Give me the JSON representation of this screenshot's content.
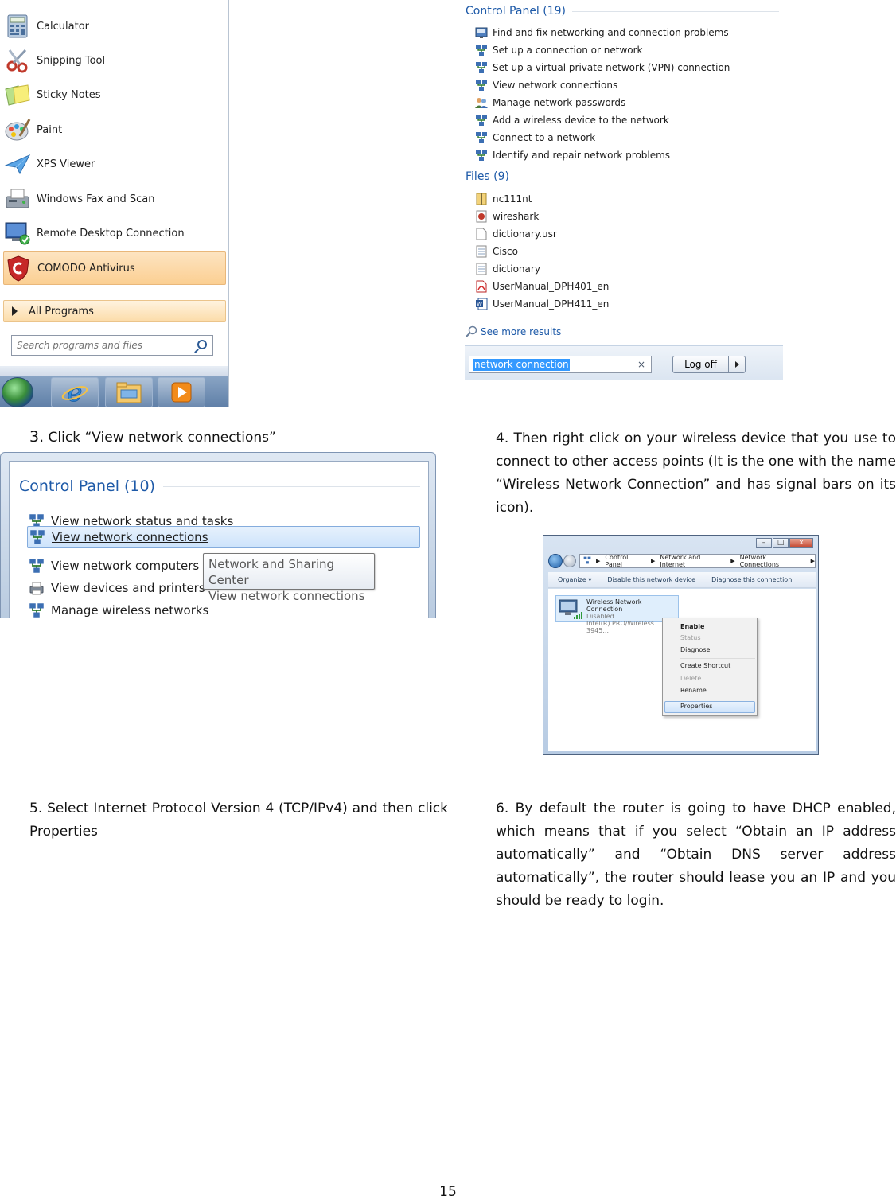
{
  "start_menu": {
    "items": [
      {
        "label": "Calculator",
        "icon": "calculator-icon"
      },
      {
        "label": "Snipping Tool",
        "icon": "scissors-icon"
      },
      {
        "label": "Sticky Notes",
        "icon": "sticky-notes-icon"
      },
      {
        "label": "Paint",
        "icon": "paint-palette-icon"
      },
      {
        "label": "XPS Viewer",
        "icon": "paper-plane-icon"
      },
      {
        "label": "Windows Fax and Scan",
        "icon": "fax-icon"
      },
      {
        "label": "Remote Desktop Connection",
        "icon": "remote-desktop-icon"
      },
      {
        "label": "COMODO Antivirus",
        "icon": "comodo-shield-icon",
        "highlighted": true
      }
    ],
    "all_programs_label": "All Programs",
    "search_placeholder": "Search programs and files",
    "taskbar_icons": [
      "start-orb-icon",
      "internet-explorer-icon",
      "file-explorer-icon",
      "media-player-icon"
    ]
  },
  "search_results": {
    "control_panel_heading": "Control Panel (19)",
    "control_panel_items": [
      {
        "label": "Find and fix networking and connection problems",
        "icon": "troubleshoot-icon"
      },
      {
        "label": "Set up a connection or network",
        "icon": "network-icon"
      },
      {
        "label": "Set up a virtual private network (VPN) connection",
        "icon": "network-icon"
      },
      {
        "label": "View network connections",
        "icon": "network-icon"
      },
      {
        "label": "Manage network passwords",
        "icon": "users-icon"
      },
      {
        "label": "Add a wireless device to the network",
        "icon": "network-icon"
      },
      {
        "label": "Connect to a network",
        "icon": "network-icon"
      },
      {
        "label": "Identify and repair network problems",
        "icon": "network-icon"
      }
    ],
    "files_heading": "Files (9)",
    "file_items": [
      {
        "label": "nc111nt",
        "icon": "archive-icon"
      },
      {
        "label": "wireshark",
        "icon": "wireshark-icon"
      },
      {
        "label": "dictionary.usr",
        "icon": "blank-file-icon"
      },
      {
        "label": "Cisco",
        "icon": "text-file-icon"
      },
      {
        "label": "dictionary",
        "icon": "text-file-icon"
      },
      {
        "label": "UserManual_DPH401_en",
        "icon": "pdf-icon"
      },
      {
        "label": "UserManual_DPH411_en",
        "icon": "word-doc-icon"
      }
    ],
    "see_more_label": "See more results",
    "search_value": "network connection",
    "clear_symbol": "×",
    "log_off_label": "Log off"
  },
  "step3": {
    "number": "3.",
    "text": " Click “View network connections”"
  },
  "control_panel_popup": {
    "heading": "Control Panel (10)",
    "items": [
      {
        "label": "View network status and tasks"
      },
      {
        "label": "View network connections",
        "selected": true
      },
      {
        "label": "View network computers a"
      },
      {
        "label": "View devices and printers"
      },
      {
        "label": "Manage wireless networks"
      }
    ],
    "tooltip_line1": "Network and Sharing Center",
    "tooltip_line2": "View network connections"
  },
  "step4": {
    "text": "4. Then right click on your wireless device that you use to connect to other access points (It is the one with the name “Wireless Network Connection” and has signal bars on its icon)."
  },
  "network_window": {
    "breadcrumb": [
      "Control Panel",
      "Network and Internet",
      "Network Connections"
    ],
    "toolbar": [
      "Organize ▾",
      "Disable this network device",
      "Diagnose this connection"
    ],
    "connection": {
      "name": "Wireless Network Connection",
      "status": "Disabled",
      "adapter": "Intel(R) PRO/Wireless 3945..."
    },
    "context_menu": [
      "Enable",
      "Status",
      "Diagnose",
      "Create Shortcut",
      "Delete",
      "Rename",
      "Properties"
    ]
  },
  "step5": {
    "text": "5. Select Internet Protocol Version 4 (TCP/IPv4) and then click Properties"
  },
  "step6": {
    "text": "6. By default the router is going to have DHCP enabled, which means that if you select “Obtain an IP address automatically” and “Obtain DNS server address automatically”, the router should lease you an IP and you should be ready to login."
  },
  "page_number": "15",
  "colors": {
    "link_blue": "#1e5aa8",
    "highlight_orange": "#fbcf92",
    "selection_blue": "#3399ff"
  }
}
